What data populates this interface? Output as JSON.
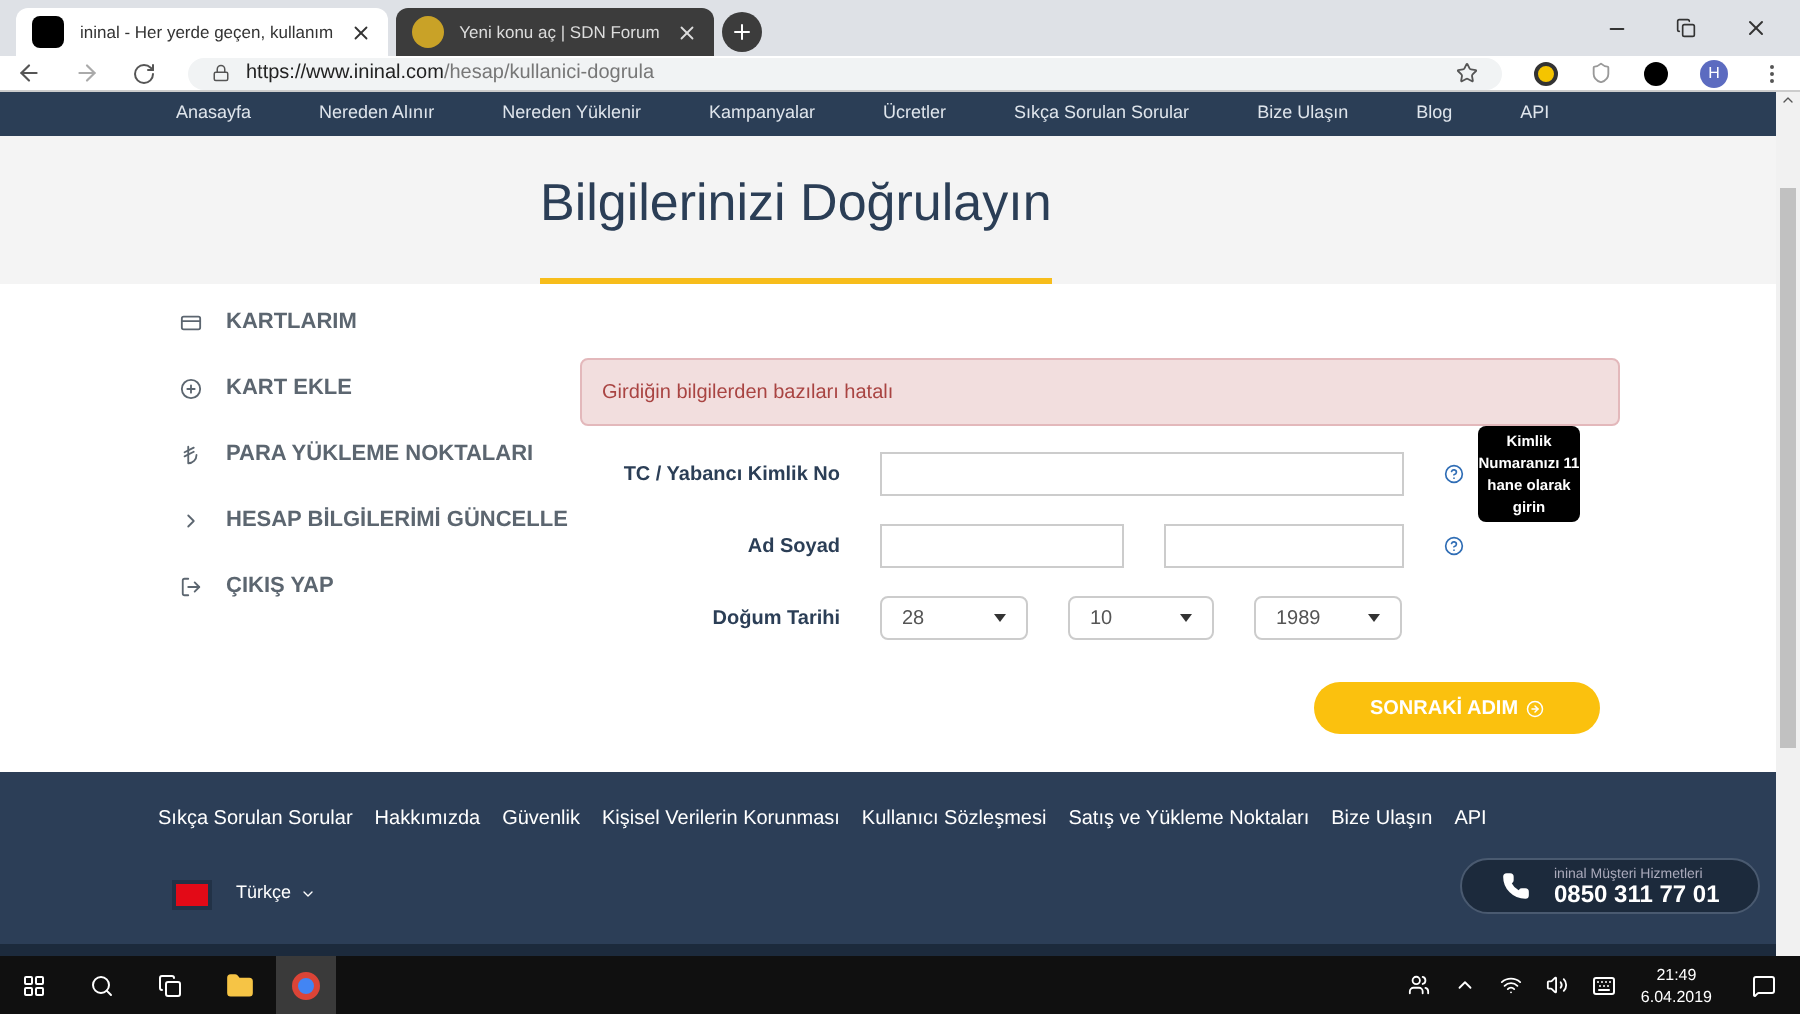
{
  "browser": {
    "tabs": [
      {
        "title": "ininal - Her yerde geçen, kullanım",
        "selected": true
      },
      {
        "title": "Yeni konu aç | SDN Forum",
        "selected": false
      }
    ],
    "url_host": "https://www.ininal.com",
    "url_path": "/hesap/kullanici-dogrula",
    "profile": "H"
  },
  "nav": [
    "Anasayfa",
    "Nereden Alınır",
    "Nereden Yüklenir",
    "Kampanyalar",
    "Ücretler",
    "Sıkça Sorulan Sorular",
    "Bize Ulaşın",
    "Blog",
    "API"
  ],
  "title": "Bilgilerinizi Doğrulayın",
  "sidebar": [
    {
      "label": "KARTLARIM"
    },
    {
      "label": "KART EKLE"
    },
    {
      "label": "PARA YÜKLEME NOKTALARI"
    },
    {
      "label": "HESAP BİLGİLERİMİ GÜNCELLE"
    },
    {
      "label": "ÇIKIŞ YAP"
    }
  ],
  "alert": "Girdiğin bilgilerden bazıları hatalı",
  "form": {
    "id_label": "TC / Yabancı Kimlik No",
    "tooltip": "Kimlik Numaranızı 11 hane olarak girin",
    "name_label": "Ad Soyad",
    "birth_label": "Doğum Tarihi",
    "birth": [
      "28",
      "10",
      "1989"
    ],
    "next": "SONRAKİ ADIM"
  },
  "footer": {
    "links": [
      "Sıkça Sorulan Sorular",
      "Hakkımızda",
      "Güvenlik",
      "Kişisel Verilerin Korunması",
      "Kullanıcı Sözleşmesi",
      "Satış ve Yükleme Noktaları",
      "Bize Ulaşın",
      "API"
    ],
    "language": "Türkçe",
    "support_label": "ininal Müşteri Hizmetleri",
    "phone": "0850 311 77 01"
  },
  "taskbar": {
    "time": "21:49",
    "date": "6.04.2019"
  }
}
